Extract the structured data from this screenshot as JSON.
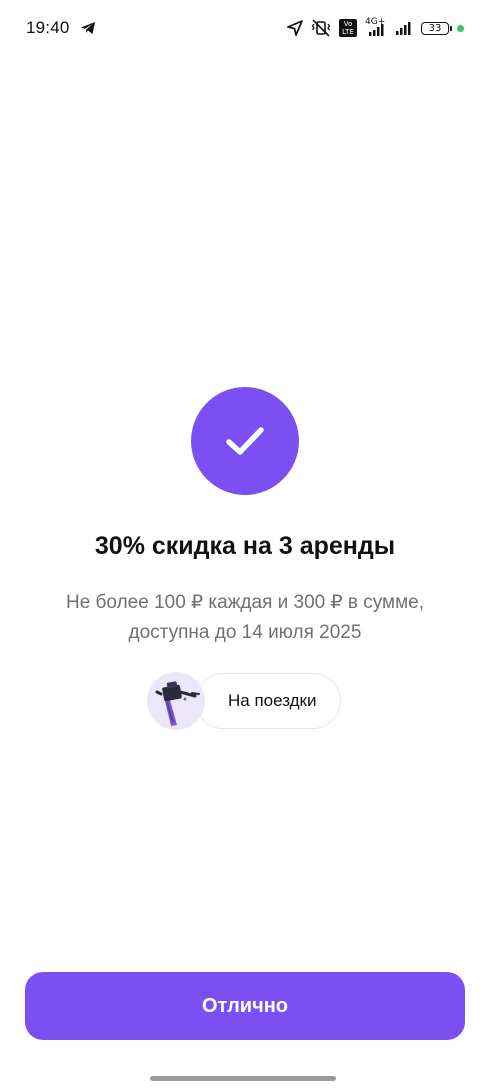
{
  "status_bar": {
    "time": "19:40",
    "network_label": "4G+",
    "volte_label": "Vo LTE",
    "battery_level": "33",
    "icons": [
      "telegram-icon",
      "location-arrow-icon",
      "vibrate-off-icon",
      "volte-icon",
      "signal-icon",
      "signal-icon",
      "battery-icon",
      "green-dot-indicator"
    ]
  },
  "success": {
    "icon": "checkmark-icon",
    "title": "30% скидка на 3 аренды",
    "subtitle_line1": "Не более 100 ₽ каждая и 300 ₽ в сумме,",
    "subtitle_line2": "доступна до 14 июля 2025",
    "chip_label": "На поездки",
    "chip_icon": "scooter-icon"
  },
  "actions": {
    "confirm_label": "Отлично"
  },
  "colors": {
    "accent": "#7b4ff2",
    "subtitle": "#707070",
    "chip_bg": "#ece6fb"
  }
}
